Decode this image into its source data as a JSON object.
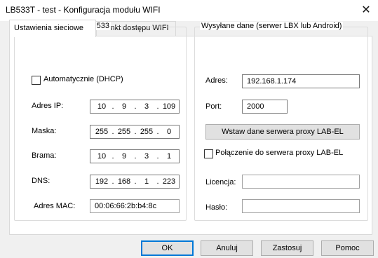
{
  "window": {
    "title": "LB533T - test - Konfiguracja modułu WIFI",
    "close_glyph": "✕"
  },
  "tabs": [
    {
      "label": "Ustawienia sieciowe",
      "active": true
    },
    {
      "label": "Punkt dostępu WIFI",
      "active": false
    }
  ],
  "recorder": {
    "group_title": "Adres rejestratora LB-533",
    "dhcp_label": "Automatycznie (DHCP)",
    "dhcp_checked": false,
    "ip_label": "Adres IP:",
    "ip": [
      "10",
      "9",
      "3",
      "109"
    ],
    "mask_label": "Maska:",
    "mask": [
      "255",
      "255",
      "255",
      "0"
    ],
    "gateway_label": "Brama:",
    "gateway": [
      "10",
      "9",
      "3",
      "1"
    ],
    "dns_label": "DNS:",
    "dns": [
      "192",
      "168",
      "1",
      "223"
    ],
    "mac_label": "Adres MAC:",
    "mac": "00:06:66:2b:b4:8c"
  },
  "server": {
    "group_title": "Wysyłane dane (serwer LBX lub Android)",
    "address_label": "Adres:",
    "address": "192.168.1.174",
    "port_label": "Port:",
    "port": "2000",
    "proxy_button": "Wstaw dane serwera proxy LAB-EL",
    "proxy_check_label": "Połączenie do serwera proxy LAB-EL",
    "proxy_checked": false,
    "license_label": "Licencja:",
    "license": "",
    "password_label": "Hasło:",
    "password": ""
  },
  "buttons": {
    "ok": "OK",
    "cancel": "Anuluj",
    "apply": "Zastosuj",
    "help": "Pomoc"
  }
}
